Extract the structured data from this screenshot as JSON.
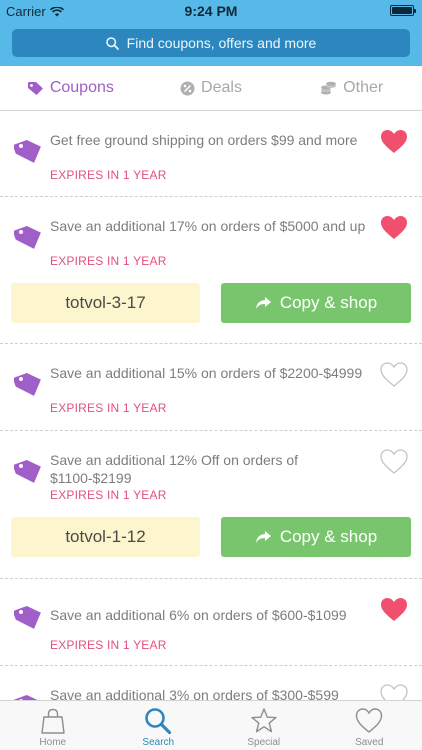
{
  "status_bar": {
    "carrier": "Carrier",
    "time": "9:24 PM"
  },
  "search": {
    "placeholder": "Find coupons, offers and more"
  },
  "tabs": [
    {
      "label": "Coupons",
      "active": true,
      "icon": "tag-icon"
    },
    {
      "label": "Deals",
      "active": false,
      "icon": "discount-icon"
    },
    {
      "label": "Other",
      "active": false,
      "icon": "coins-icon"
    }
  ],
  "coupons": [
    {
      "text": "Get free ground shipping on orders $99 and more",
      "expires": "EXPIRES IN 1 YEAR",
      "saved": true,
      "code": ""
    },
    {
      "text": "Save an additional 17% on orders of $5000 and up",
      "expires": "EXPIRES IN 1 YEAR",
      "saved": true,
      "code": "totvol-3-17",
      "action": "Copy & shop"
    },
    {
      "text": "Save an additional 15% on orders of $2200-$4999",
      "expires": "EXPIRES IN 1 YEAR",
      "saved": false,
      "code": ""
    },
    {
      "text": "Save an additional 12% Off on orders of $1100-$2199",
      "expires": "EXPIRES IN 1 YEAR",
      "saved": false,
      "code": "totvol-1-12",
      "action": "Copy & shop"
    },
    {
      "text": "Save an additional 6% on orders of $600-$1099",
      "expires": "EXPIRES IN 1 YEAR",
      "saved": true,
      "code": ""
    },
    {
      "text": "Save an additional 3% on orders of $300-$599",
      "expires": "",
      "saved": false,
      "code": ""
    }
  ],
  "tabbar": [
    {
      "label": "Home",
      "icon": "shopping-bag-icon",
      "active": false
    },
    {
      "label": "Search",
      "icon": "search-icon",
      "active": true
    },
    {
      "label": "Special",
      "icon": "star-icon",
      "active": false
    },
    {
      "label": "Saved",
      "icon": "heart-icon",
      "active": false
    }
  ],
  "colors": {
    "header": "#56b9e8",
    "search_bar": "#2d87bf",
    "accent_purple": "#a05fc8",
    "heart_red": "#f0506e",
    "expires_red": "#e2517a",
    "copy_green": "#79c56e",
    "code_bg": "#fdf5cd"
  }
}
